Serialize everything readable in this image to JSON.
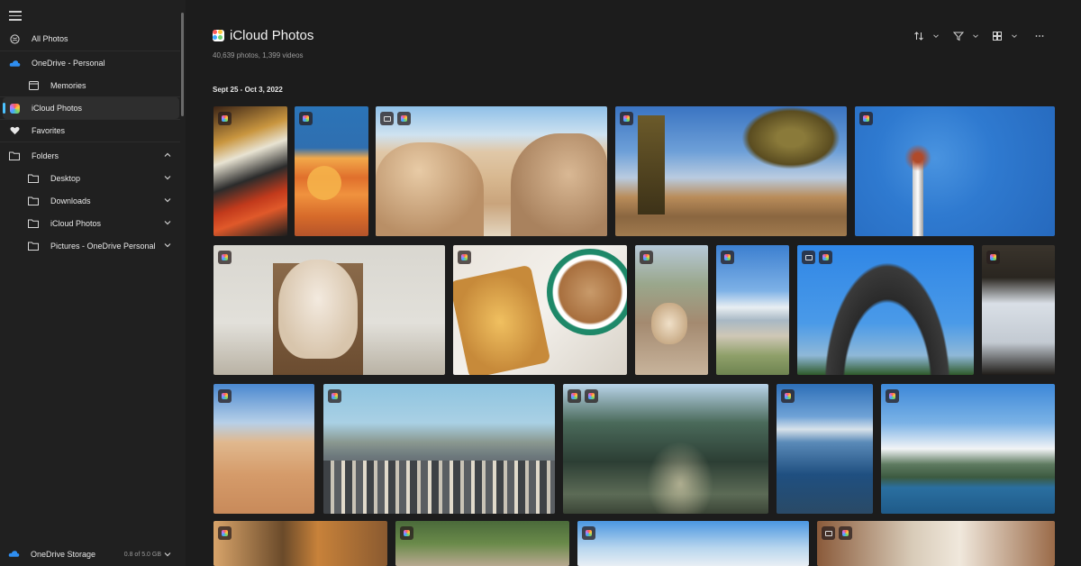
{
  "sidebar": {
    "items": [
      {
        "label": "All Photos",
        "icon": "globe-icon"
      },
      {
        "label": "OneDrive - Personal",
        "icon": "cloud-icon"
      },
      {
        "label": "Memories",
        "icon": "calendar-icon"
      },
      {
        "label": "iCloud Photos",
        "icon": "icloud-photos-icon"
      },
      {
        "label": "Favorites",
        "icon": "heart-icon"
      },
      {
        "label": "Folders",
        "icon": "folder-icon"
      },
      {
        "label": "Desktop",
        "icon": "folder-icon"
      },
      {
        "label": "Downloads",
        "icon": "folder-icon"
      },
      {
        "label": "iCloud Photos",
        "icon": "folder-icon"
      },
      {
        "label": "Pictures - OneDrive Personal",
        "icon": "folder-icon"
      }
    ],
    "storage": {
      "label": "OneDrive Storage",
      "value": "0.8 of 5.0 GB"
    }
  },
  "main": {
    "title": "iCloud Photos",
    "subtitle": "40,639 photos, 1,399 videos",
    "date_range": "Sept 25 - Oct 3, 2022"
  },
  "colors": {
    "accent": "#4cc2ff",
    "background": "#1c1c1c",
    "sidebar": "#202020"
  }
}
